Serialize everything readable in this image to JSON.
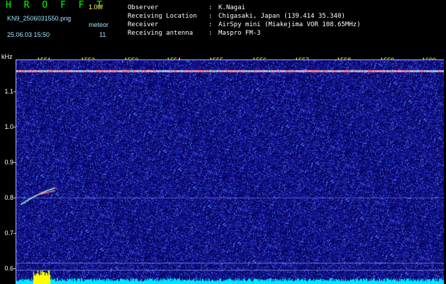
{
  "header": {
    "app_title": "H R O F F T",
    "version": "1.00f",
    "filename": "KN9_2506031550.png",
    "mode_label": "meteor",
    "datetime": "25.06.03 15:50",
    "mode_value": "11"
  },
  "info": [
    {
      "key": "Observer",
      "sep": ":",
      "value": "K.Nagai"
    },
    {
      "key": "Receiving Location",
      "sep": ":",
      "value": "Chigasaki, Japan (139.414 35.340)"
    },
    {
      "key": "Receiver",
      "sep": ":",
      "value": "AirSpy mini (Miakejima VOR 108.65MHz)"
    },
    {
      "key": "Receiving antenna",
      "sep": ":",
      "value": "Maspro FM-3"
    }
  ],
  "axis": {
    "unit": "kHz",
    "time_ticks": [
      "1551",
      "1552",
      "1553",
      "1554",
      "1555",
      "1556",
      "1557",
      "1558",
      "1559",
      "1600"
    ],
    "freq_ticks": [
      "1.1",
      "1.0",
      "0.9",
      "0.8",
      "0.7",
      "0.6"
    ]
  },
  "colors": {
    "background": "#000000",
    "title": "#00ff00",
    "tick_text": "#ffff66",
    "plot_base": "#0a0a7a",
    "carrier_line": "#ff6666",
    "bottom_band": "#00e5ff",
    "burst": "#ffff00"
  }
}
